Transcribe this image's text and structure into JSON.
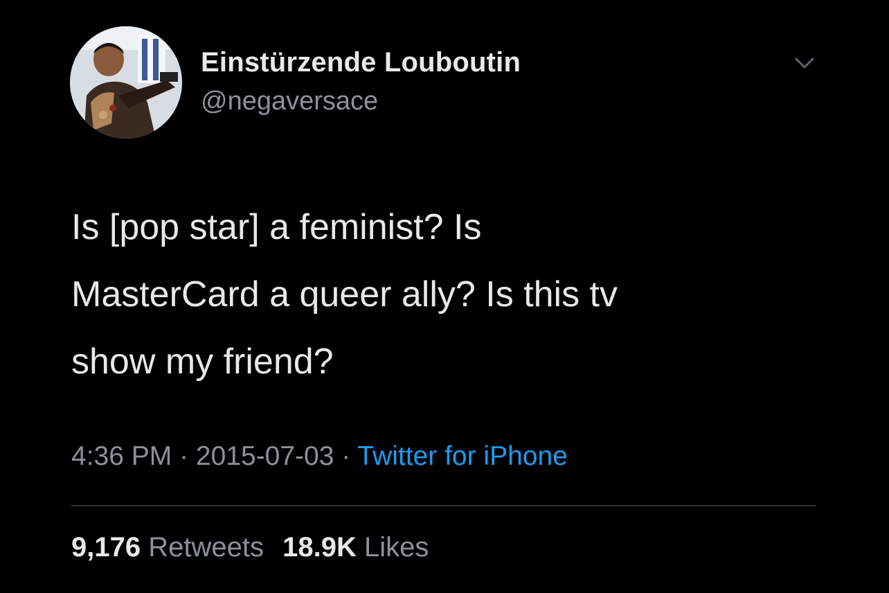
{
  "colors": {
    "background": "#000000",
    "primary_text": "#e7e9ea",
    "secondary_text": "#8b9299",
    "link": "#1d9bf0",
    "divider": "#2a2e33"
  },
  "author": {
    "display_name": "Einstürzende Louboutin",
    "handle": "@negaversace",
    "avatar_icon": "user-avatar-photo"
  },
  "menu": {
    "icon": "chevron-down-icon"
  },
  "tweet": {
    "text": "Is [pop star] a feminist? Is\nMasterCard a queer ally? Is this tv\nshow my friend?"
  },
  "meta": {
    "time": "4:36 PM",
    "separator": " · ",
    "date": "2015-07-03",
    "source": "Twitter for iPhone"
  },
  "stats": {
    "retweets_count": "9,176",
    "retweets_label": "Retweets",
    "likes_count": "18.9K",
    "likes_label": "Likes"
  }
}
